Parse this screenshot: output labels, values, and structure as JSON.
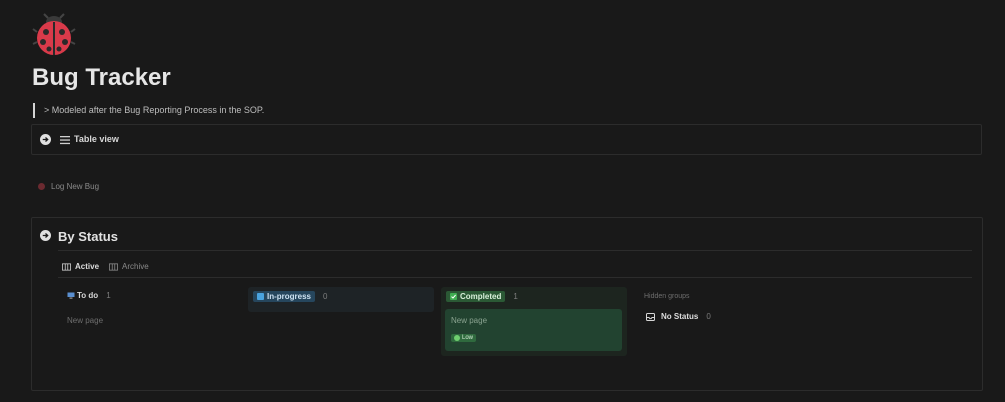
{
  "page": {
    "icon": "ladybug-icon",
    "title": "Bug Tracker",
    "quote": "> Modeled after the Bug Reporting Process in the SOP."
  },
  "table_view": {
    "label": "Table view"
  },
  "log_bug": {
    "label": "Log New Bug"
  },
  "by_status": {
    "title": "By Status",
    "tabs": [
      {
        "label": "Active",
        "active": true
      },
      {
        "label": "Archive",
        "active": false
      }
    ],
    "columns": [
      {
        "label": "To do",
        "count": "1",
        "new_page": "New page"
      },
      {
        "label": "In-progress",
        "count": "0"
      },
      {
        "label": "Completed",
        "count": "1",
        "card_title": "New page",
        "card_tag": "Low"
      }
    ],
    "hidden_groups_label": "Hidden groups",
    "no_status": {
      "label": "No Status",
      "count": "0"
    }
  },
  "colors": {
    "background": "#191919",
    "in_progress": "#26465d",
    "completed": "#2b5935",
    "low_tag": "#2f6a3e"
  }
}
